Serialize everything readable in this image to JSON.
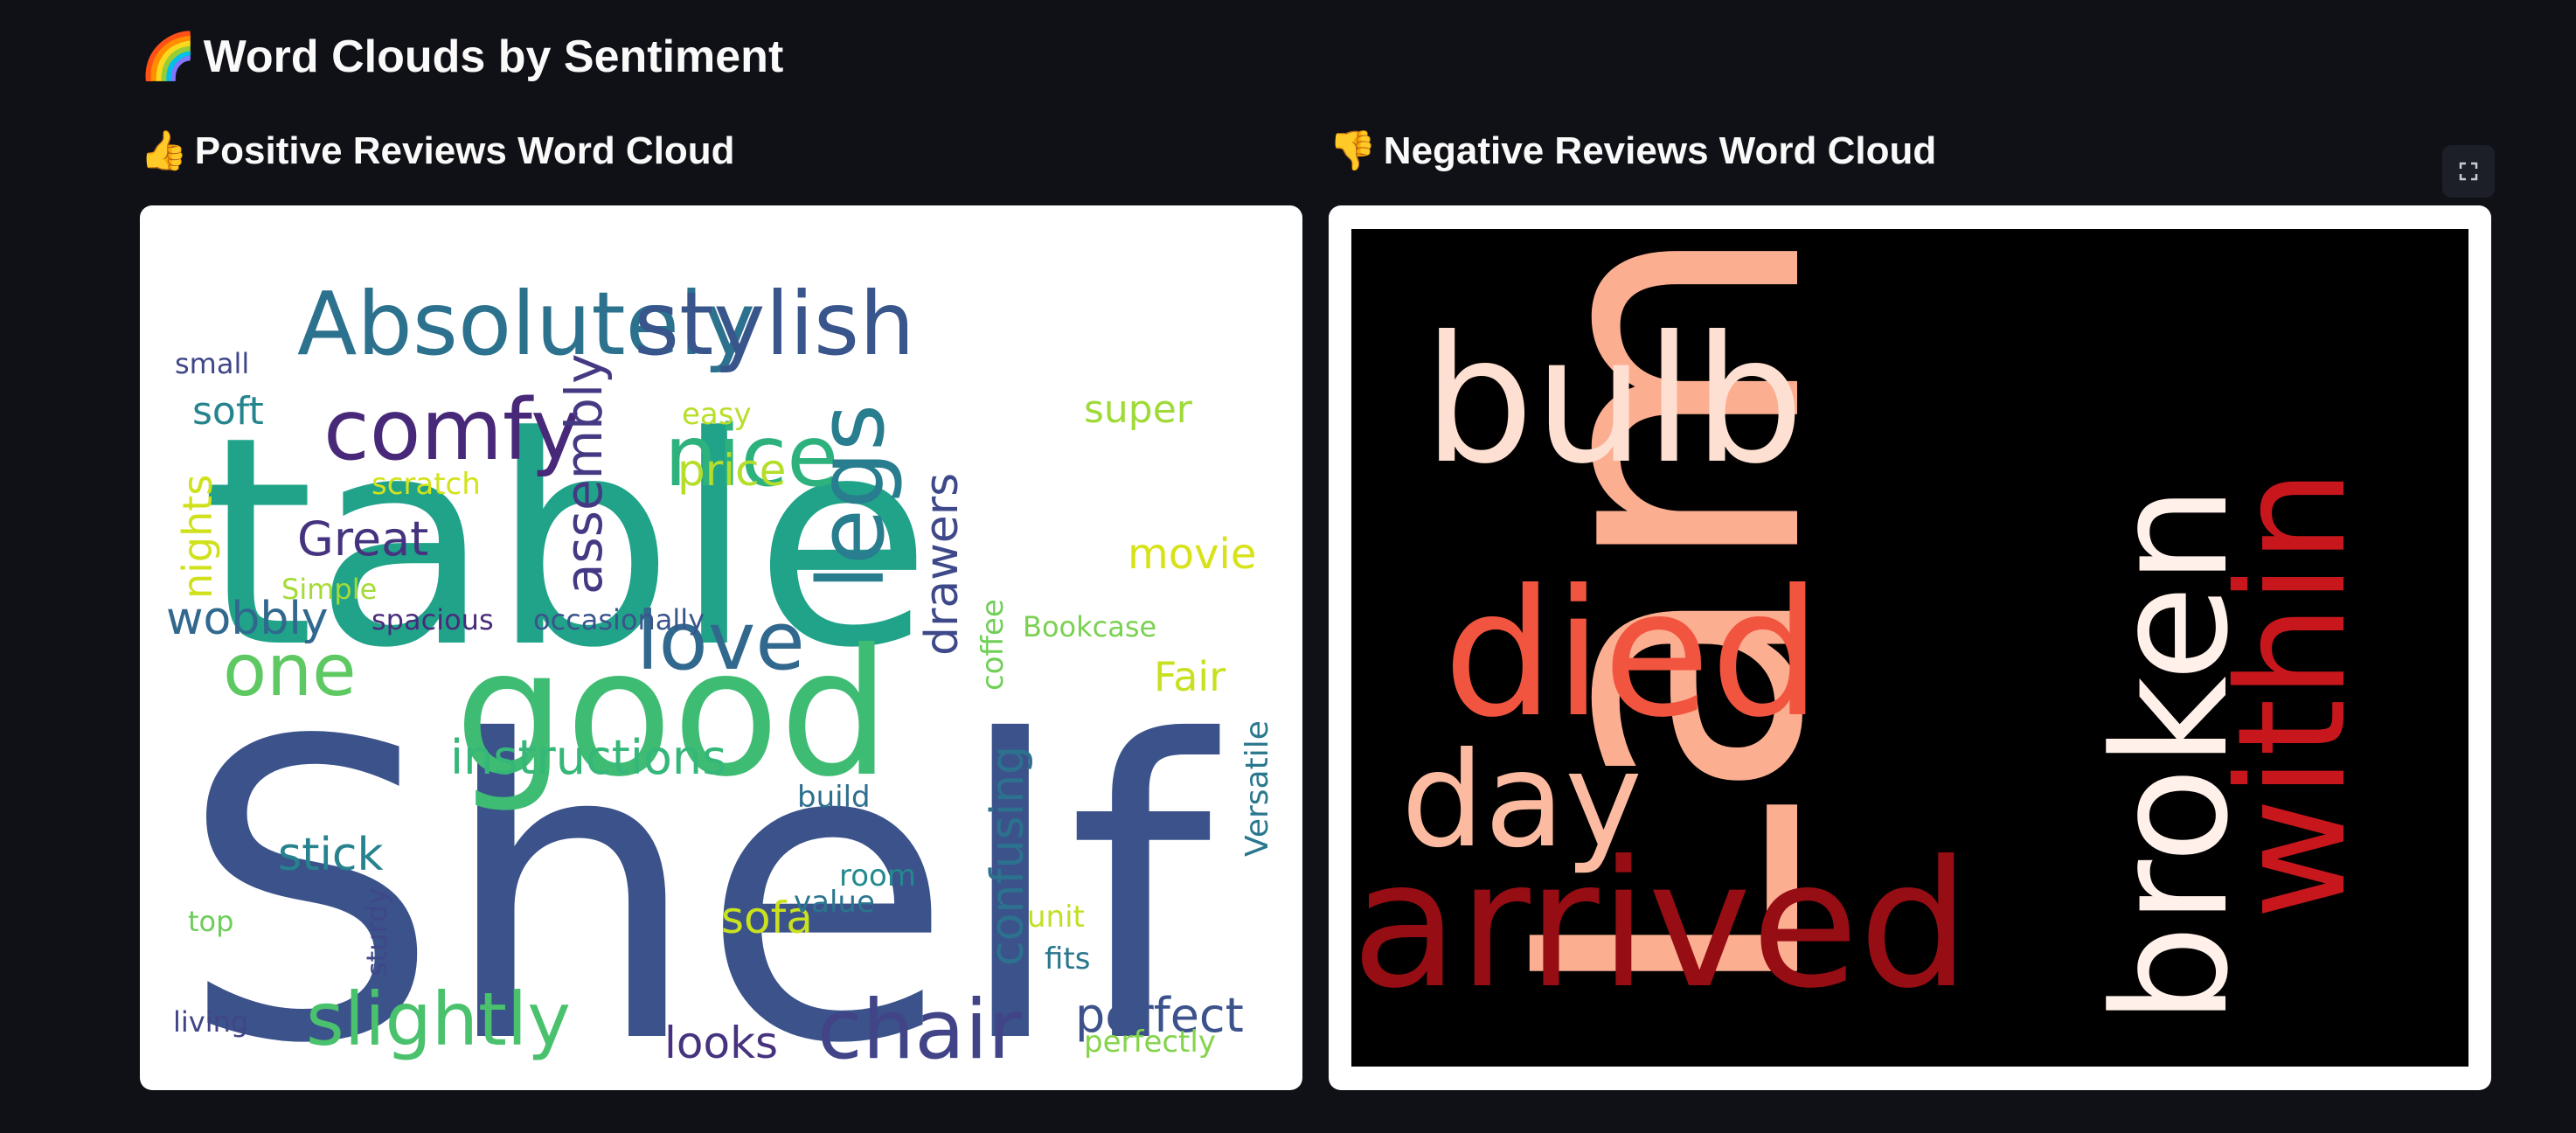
{
  "page": {
    "title": "Word Clouds by Sentiment",
    "title_icon": "rainbow-icon",
    "title_icon_glyph": "🌈"
  },
  "positive": {
    "heading": "Positive Reviews Word Cloud",
    "icon": "thumbs-up-icon",
    "icon_glyph": "👍",
    "background": "#ffffff",
    "words": [
      {
        "text": "Shelf",
        "color": "#3b528b"
      },
      {
        "text": "table",
        "color": "#21a38a"
      },
      {
        "text": "good",
        "color": "#3fbc73"
      },
      {
        "text": "Absolutely",
        "color": "#2c728e"
      },
      {
        "text": "stylish",
        "color": "#39568c"
      },
      {
        "text": "comfy",
        "color": "#482878"
      },
      {
        "text": "nice",
        "color": "#2db27d"
      },
      {
        "text": "legs",
        "color": "#287d8e"
      },
      {
        "text": "love",
        "color": "#31688e"
      },
      {
        "text": "one",
        "color": "#5ec962"
      },
      {
        "text": "chair",
        "color": "#414487"
      },
      {
        "text": "slightly",
        "color": "#4ac16d"
      },
      {
        "text": "instructions",
        "color": "#35b779"
      },
      {
        "text": "confusing",
        "color": "#2c728e"
      },
      {
        "text": "assembly",
        "color": "#443983"
      },
      {
        "text": "drawers",
        "color": "#3e4989"
      },
      {
        "text": "Great",
        "color": "#46337f"
      },
      {
        "text": "wobbly",
        "color": "#31688e"
      },
      {
        "text": "stick",
        "color": "#26828e"
      },
      {
        "text": "perfect",
        "color": "#3b528b"
      },
      {
        "text": "looks",
        "color": "#46327e"
      },
      {
        "text": "sofa",
        "color": "#cae11f"
      },
      {
        "text": "price",
        "color": "#b5de2b"
      },
      {
        "text": "movie",
        "color": "#d8e219"
      },
      {
        "text": "nights",
        "color": "#d0e11c"
      },
      {
        "text": "Fair",
        "color": "#c8e020"
      },
      {
        "text": "super",
        "color": "#a0da39"
      },
      {
        "text": "soft",
        "color": "#25848e"
      },
      {
        "text": "small",
        "color": "#404688"
      },
      {
        "text": "easy",
        "color": "#b8de29"
      },
      {
        "text": "scratch",
        "color": "#d2e21b"
      },
      {
        "text": "Simple",
        "color": "#a5db36"
      },
      {
        "text": "spacious",
        "color": "#472c7a"
      },
      {
        "text": "occasionally",
        "color": "#3a548c"
      },
      {
        "text": "coffee",
        "color": "#70cf57"
      },
      {
        "text": "Bookcase",
        "color": "#7ad151"
      },
      {
        "text": "Versatile",
        "color": "#2a788e"
      },
      {
        "text": "build",
        "color": "#2e6e8e"
      },
      {
        "text": "room",
        "color": "#23898e"
      },
      {
        "text": "value",
        "color": "#2a768e"
      },
      {
        "text": "unit",
        "color": "#c2df23"
      },
      {
        "text": "fits",
        "color": "#2a768e"
      },
      {
        "text": "perfectly",
        "color": "#84d44b"
      },
      {
        "text": "top",
        "color": "#6ccd5a"
      },
      {
        "text": "sturdy",
        "color": "#3f4788"
      },
      {
        "text": "living",
        "color": "#414487"
      }
    ]
  },
  "negative": {
    "heading": "Negative Reviews Word Cloud",
    "icon": "thumbs-down-icon",
    "icon_glyph": "👎",
    "background": "#000000",
    "words": [
      {
        "text": "Lamp",
        "color": "#fcae91"
      },
      {
        "text": "bulb",
        "color": "#fee0d2"
      },
      {
        "text": "died",
        "color": "#f2553f"
      },
      {
        "text": "day",
        "color": "#fcbba1"
      },
      {
        "text": "arrived",
        "color": "#960d14"
      },
      {
        "text": "broken",
        "color": "#fff0ea"
      },
      {
        "text": "within",
        "color": "#c8171c"
      }
    ]
  },
  "toolbar": {
    "fullscreen_icon": "fullscreen-icon"
  }
}
